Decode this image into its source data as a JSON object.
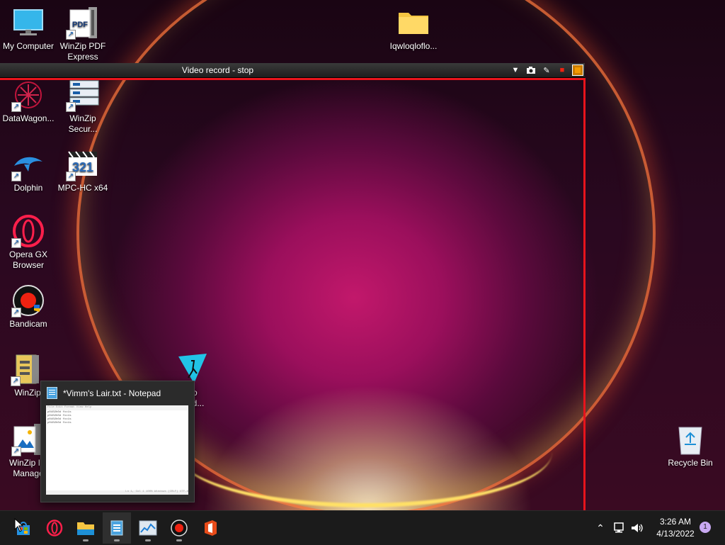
{
  "desktop": {
    "icons": [
      {
        "label": "My Computer"
      },
      {
        "label": "WinZip PDF Express"
      },
      {
        "label": "Iqwloqloflo..."
      },
      {
        "label": "DataWagon..."
      },
      {
        "label": "WinZip Secur..."
      },
      {
        "label": "Dolphin"
      },
      {
        "label": "MPC-HC x64"
      },
      {
        "label": "Opera GX Browser"
      },
      {
        "label": "Bandicam"
      },
      {
        "label": "WinZip"
      },
      {
        "label": "no\nload..."
      },
      {
        "label": "WinZip Im Manage"
      },
      {
        "label": "Recycle Bin"
      }
    ],
    "pdf_badge": "PDF",
    "mpc_badge": "321"
  },
  "recorder": {
    "title": "Video record - stop",
    "frame_color": "#e8141c"
  },
  "thumbnail": {
    "title": "*Vimm's Lair.txt - Notepad",
    "menu": "File  Edit  Format  View  Help",
    "lines": [
      "p0402h0d  fcc1s",
      "p0402h0d  fcc1s",
      "p0402h0d  fcc1s",
      "p0402h0d  fcc1s"
    ],
    "status": "Ln 1, Col 1     100%     Windows (CRLF)     UTF-8"
  },
  "taskbar": {
    "apps": [
      {
        "name": "store-icon"
      },
      {
        "name": "opera-gx-icon"
      },
      {
        "name": "file-explorer-icon"
      },
      {
        "name": "notepad-icon"
      },
      {
        "name": "task-manager-icon"
      },
      {
        "name": "bandicam-icon"
      },
      {
        "name": "office-icon"
      }
    ],
    "clock_time": "3:26 AM",
    "clock_date": "4/13/2022",
    "notification_count": "1"
  },
  "colors": {
    "accent_red": "#e8141c",
    "taskbar": "#1b1b1b"
  }
}
